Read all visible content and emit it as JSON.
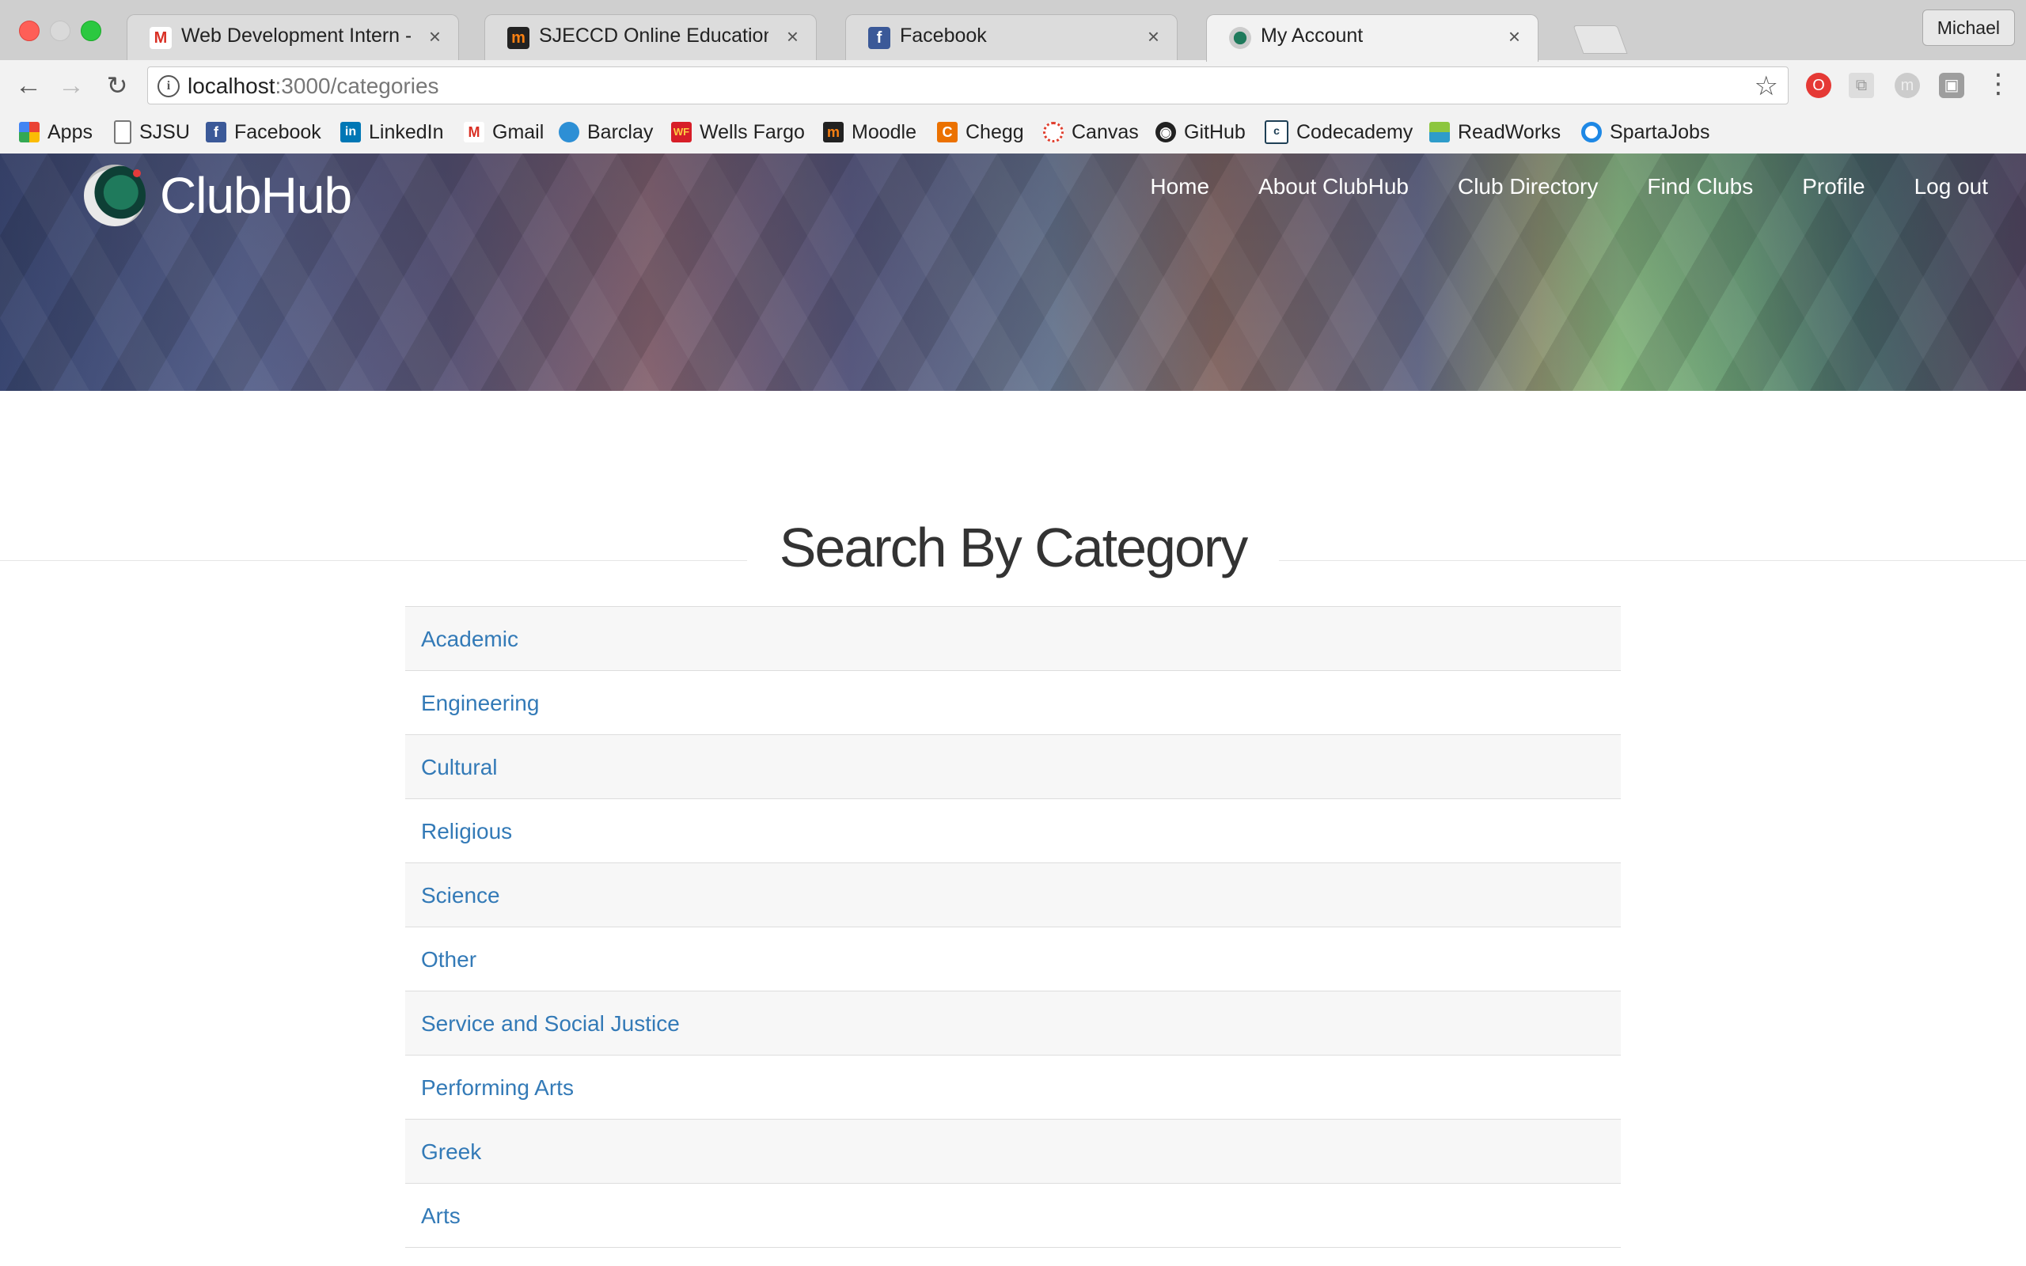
{
  "browser": {
    "tabs": [
      {
        "title": "Web Development Intern - mic",
        "favicon": "gmail-icon"
      },
      {
        "title": "SJECCD Online Education",
        "favicon": "moodle-icon"
      },
      {
        "title": "Facebook",
        "favicon": "facebook-icon"
      },
      {
        "title": "My Account",
        "favicon": "clubhub-icon",
        "active": true
      }
    ],
    "profile_name": "Michael",
    "url_host": "localhost",
    "url_path": ":3000/categories",
    "bookmarks": [
      {
        "label": "Apps",
        "icon": "apps-grid-icon"
      },
      {
        "label": "SJSU",
        "icon": "page-icon"
      },
      {
        "label": "Facebook",
        "icon": "facebook-icon"
      },
      {
        "label": "LinkedIn",
        "icon": "linkedin-icon"
      },
      {
        "label": "Gmail",
        "icon": "gmail-icon"
      },
      {
        "label": "Barclay",
        "icon": "barclay-icon"
      },
      {
        "label": "Wells Fargo",
        "icon": "wells-fargo-icon"
      },
      {
        "label": "Moodle",
        "icon": "moodle-icon"
      },
      {
        "label": "Chegg",
        "icon": "chegg-icon"
      },
      {
        "label": "Canvas",
        "icon": "canvas-icon"
      },
      {
        "label": "GitHub",
        "icon": "github-icon"
      },
      {
        "label": "Codecademy",
        "icon": "codecademy-icon"
      },
      {
        "label": "ReadWorks",
        "icon": "readworks-icon"
      },
      {
        "label": "SpartaJobs",
        "icon": "spartajobs-icon"
      }
    ]
  },
  "site": {
    "brand": "ClubHub",
    "nav": [
      "Home",
      "About ClubHub",
      "Club Directory",
      "Find Clubs",
      "Profile",
      "Log out"
    ],
    "link_color": "#337ab7"
  },
  "main": {
    "heading": "Search By Category",
    "categories": [
      "Academic",
      "Engineering",
      "Cultural",
      "Religious",
      "Science",
      "Other",
      "Service and Social Justice",
      "Performing Arts",
      "Greek",
      "Arts"
    ]
  }
}
